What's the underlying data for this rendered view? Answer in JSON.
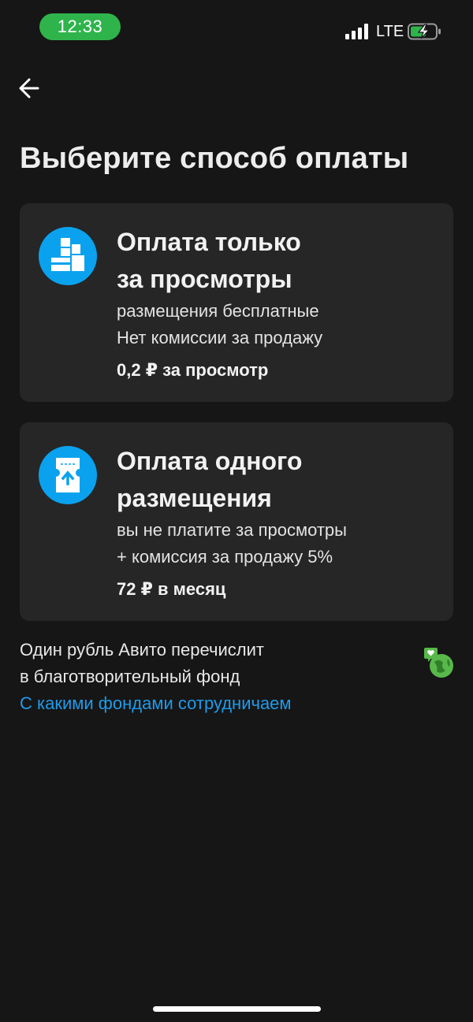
{
  "status_bar": {
    "time": "12:33",
    "network": "LTE",
    "accent_color": "#2fb44c"
  },
  "header": {
    "back_icon": "arrow-left-icon",
    "title": "Выберите способ оплаты"
  },
  "options": [
    {
      "icon": "blocks-icon",
      "title_lines": [
        "Оплата только",
        "за просмотры"
      ],
      "desc_lines": [
        "размещения бесплатные",
        "Нет комиссии за продажу"
      ],
      "price": "0,2 ₽ за просмотр"
    },
    {
      "icon": "ticket-up-icon",
      "title_lines": [
        "Оплата одного",
        "размещения"
      ],
      "desc_lines": [
        "вы не платите за просмотры",
        "+ комиссия за продажу 5%"
      ],
      "price": "72 ₽ в месяц"
    }
  ],
  "charity": {
    "text_lines": [
      "Один рубль Авито перечислит",
      "в благотворительный фонд"
    ],
    "link": "С какими фондами сотрудничаем",
    "icon": "charity-globe-icon"
  },
  "colors": {
    "background": "#161616",
    "card": "#262626",
    "icon_blue": "#0aa2ee",
    "link": "#1e9bea"
  }
}
